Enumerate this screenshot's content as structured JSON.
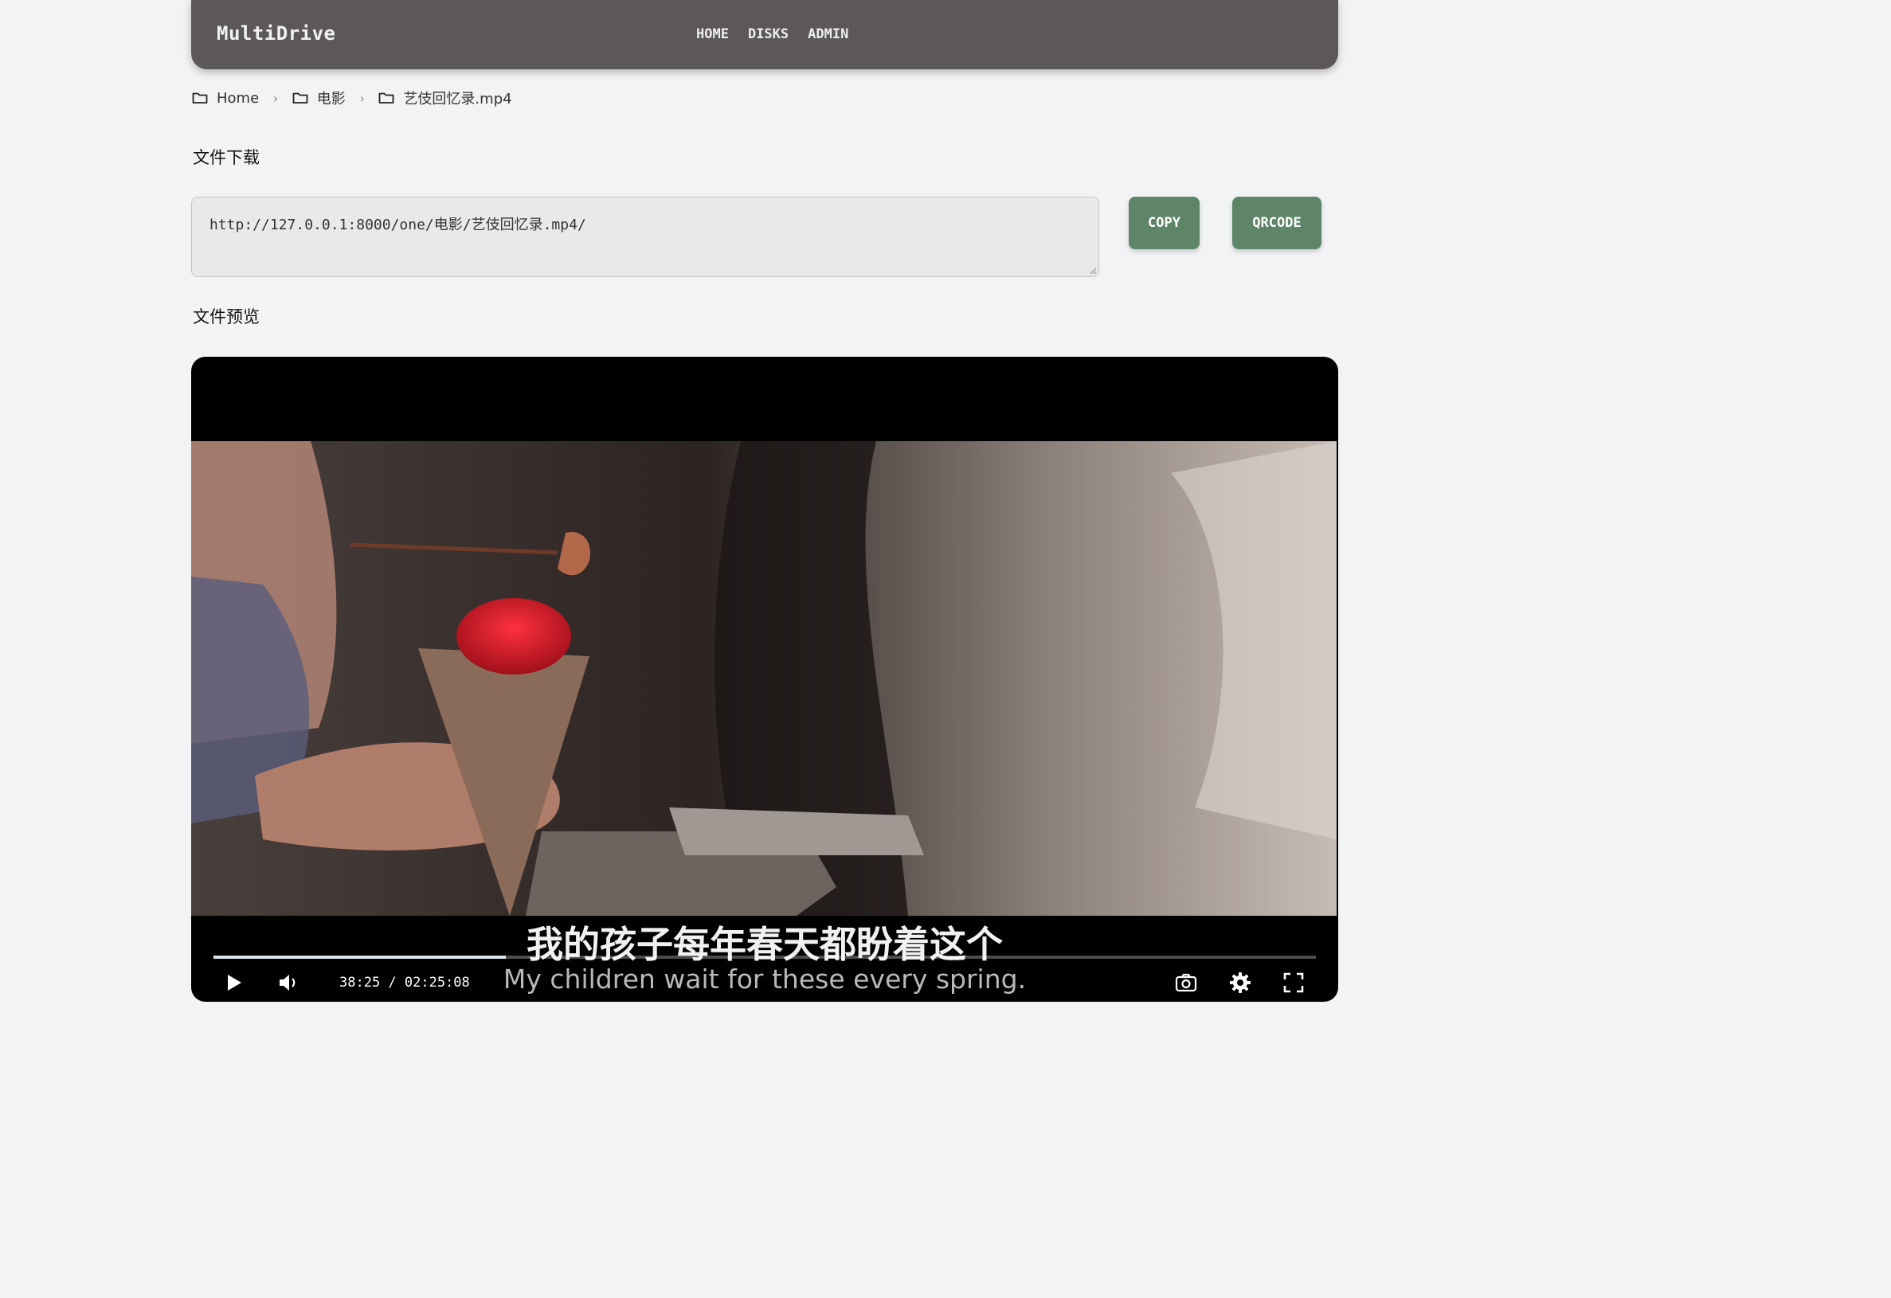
{
  "navbar": {
    "brand": "MultiDrive",
    "links": [
      "HOME",
      "DISKS",
      "ADMIN"
    ]
  },
  "breadcrumb": [
    {
      "label": "Home",
      "icon": "folder-icon"
    },
    {
      "label": "电影",
      "icon": "folder-icon"
    },
    {
      "label": "艺伎回忆录.mp4",
      "icon": "folder-icon"
    }
  ],
  "download": {
    "title": "文件下载",
    "url": "http://127.0.0.1:8000/one/电影/艺伎回忆录.mp4/",
    "copy_label": "COPY",
    "qrcode_label": "QRCODE"
  },
  "preview": {
    "title": "文件预览",
    "subtitle_cn": "我的孩子每年春天都盼着这个",
    "subtitle_en": "My children wait for these every spring.",
    "time": "38:25 / 02:25:08",
    "progress": 0.265,
    "controls": [
      "play-icon",
      "volume-icon",
      "screenshot-icon",
      "settings-icon",
      "fullscreen-icon"
    ]
  },
  "colors": {
    "navbar": "#5c5858",
    "button": "#5f8569",
    "background": "#f2f3f5"
  }
}
